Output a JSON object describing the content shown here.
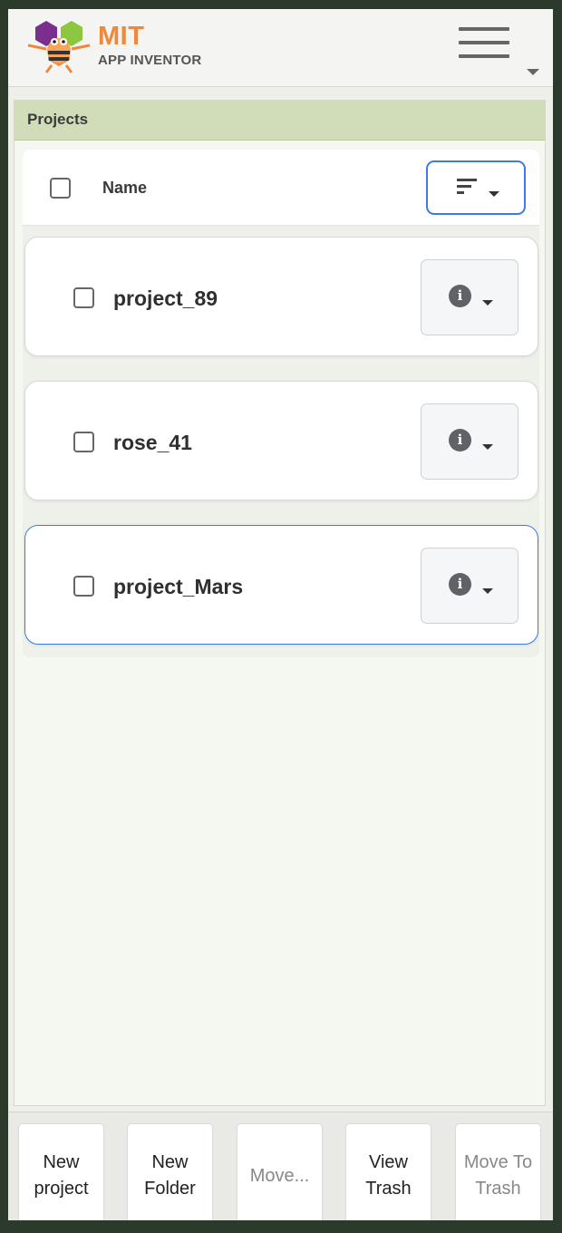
{
  "header": {
    "brand_title": "MIT",
    "brand_subtitle": "APP INVENTOR"
  },
  "panel": {
    "title": "Projects"
  },
  "list": {
    "column_name": "Name",
    "projects": [
      {
        "name": "project_89",
        "selected_outline": false
      },
      {
        "name": "rose_41",
        "selected_outline": false
      },
      {
        "name": "project_Mars",
        "selected_outline": true
      }
    ]
  },
  "toolbar": {
    "new_project_line1": "New",
    "new_project_line2": "project",
    "new_folder_line1": "New",
    "new_folder_line2": "Folder",
    "move_label": "Move...",
    "view_trash_line1": "View",
    "view_trash_line2": "Trash",
    "move_to_trash_line1": "Move To",
    "move_to_trash_line2": "Trash"
  },
  "colors": {
    "accent": "#3d7be0",
    "panel_header": "#d0ddb8",
    "brand_orange": "#f0883a"
  },
  "icons": [
    "app-inventor-logo",
    "hamburger-menu-icon",
    "sort-icon",
    "info-icon",
    "chevron-down-icon"
  ]
}
